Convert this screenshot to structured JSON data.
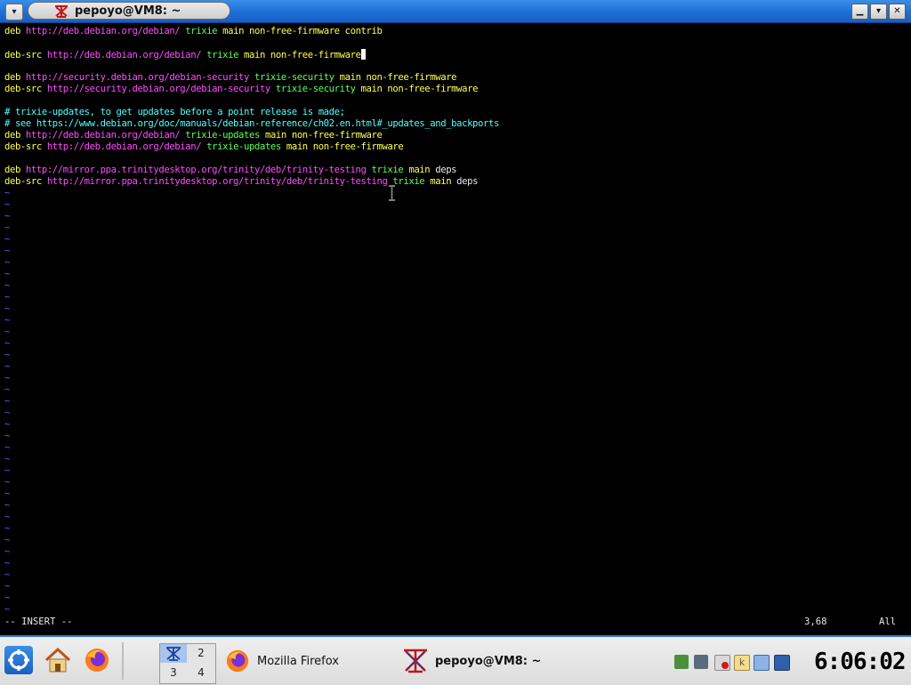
{
  "window": {
    "title": "pepoyo@VM8: ~",
    "menu_glyph": "▾",
    "shade_glyph": "▁",
    "maximize_glyph": "▾",
    "close_glyph": "✕",
    "app_icon": "trinity-konsole-icon"
  },
  "editor": {
    "lines": [
      [
        {
          "t": "deb ",
          "c": "y"
        },
        {
          "t": "http://deb.debian.org/debian/",
          "c": "m"
        },
        {
          "t": " ",
          "c": "w"
        },
        {
          "t": "trixie",
          "c": "g"
        },
        {
          "t": " main non-free-firmware contrib",
          "c": "y"
        }
      ],
      [],
      [
        {
          "t": "deb-src ",
          "c": "y"
        },
        {
          "t": "http://deb.debian.org/debian/",
          "c": "m"
        },
        {
          "t": " ",
          "c": "w"
        },
        {
          "t": "trixie",
          "c": "g"
        },
        {
          "t": " main non-free-firmware",
          "c": "y"
        }
      ],
      [],
      [
        {
          "t": "deb ",
          "c": "y"
        },
        {
          "t": "http://security.debian.org/debian-security",
          "c": "m"
        },
        {
          "t": " ",
          "c": "w"
        },
        {
          "t": "trixie-security",
          "c": "g"
        },
        {
          "t": " main non-free-firmware",
          "c": "y"
        }
      ],
      [
        {
          "t": "deb-src ",
          "c": "y"
        },
        {
          "t": "http://security.debian.org/debian-security",
          "c": "m"
        },
        {
          "t": " ",
          "c": "w"
        },
        {
          "t": "trixie-security",
          "c": "g"
        },
        {
          "t": " main non-free-firmware",
          "c": "y"
        }
      ],
      [],
      [
        {
          "t": "# trixie-updates, to get updates before a point release is made;",
          "c": "c"
        }
      ],
      [
        {
          "t": "# see https://www.debian.org/doc/manuals/debian-reference/ch02.en.html#_updates_and_backports",
          "c": "c"
        }
      ],
      [
        {
          "t": "deb ",
          "c": "y"
        },
        {
          "t": "http://deb.debian.org/debian/",
          "c": "m"
        },
        {
          "t": " ",
          "c": "w"
        },
        {
          "t": "trixie-updates",
          "c": "g"
        },
        {
          "t": " main non-free-firmware",
          "c": "y"
        }
      ],
      [
        {
          "t": "deb-src ",
          "c": "y"
        },
        {
          "t": "http://deb.debian.org/debian/",
          "c": "m"
        },
        {
          "t": " ",
          "c": "w"
        },
        {
          "t": "trixie-updates",
          "c": "g"
        },
        {
          "t": " main non-free-firmware",
          "c": "y"
        }
      ],
      [],
      [
        {
          "t": "deb ",
          "c": "y"
        },
        {
          "t": "http://mirror.ppa.trinitydesktop.org/trinity/deb/trinity-testing",
          "c": "m"
        },
        {
          "t": " ",
          "c": "w"
        },
        {
          "t": "trixie",
          "c": "g"
        },
        {
          "t": " main",
          "c": "y"
        },
        {
          "t": " deps",
          "c": "w"
        }
      ],
      [
        {
          "t": "deb-src ",
          "c": "y"
        },
        {
          "t": "http://mirror.ppa.trinitydesktop.org/trinity/deb/trinity-testing",
          "c": "m"
        },
        {
          "t": " ",
          "c": "w"
        },
        {
          "t": "trixie",
          "c": "g"
        },
        {
          "t": " main",
          "c": "y"
        },
        {
          "t": " deps",
          "c": "w"
        }
      ]
    ],
    "cursor_line": 2,
    "tilde": "~",
    "mode": "-- INSERT --",
    "position": "3,68",
    "scroll": "All"
  },
  "taskbar": {
    "launchers": [
      "trinity-menu-icon",
      "home-folder-icon",
      "firefox-icon"
    ],
    "desktops": [
      "1",
      "2",
      "3",
      "4"
    ],
    "active_desktop": "1",
    "tasks": [
      {
        "label": "Mozilla Firefox",
        "icon": "firefox-icon"
      },
      {
        "label": "pepoyo@VM8: ~",
        "icon": "trinity-konsole-icon"
      }
    ],
    "tray_icons": [
      "network-icon",
      "security-icon",
      "battery-icon",
      "knotes-icon",
      "clipboard-icon",
      "display-icon"
    ],
    "clock": "6:06:02"
  }
}
